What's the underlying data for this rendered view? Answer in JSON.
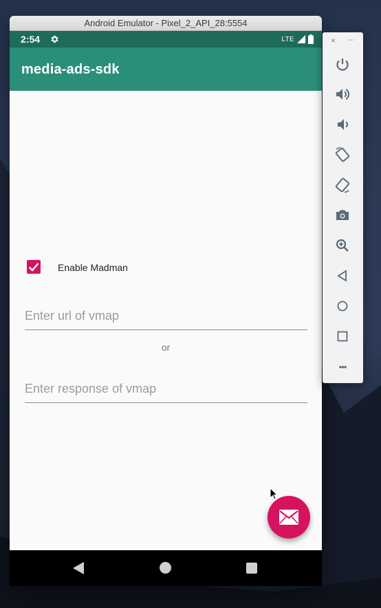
{
  "window": {
    "title": "Android Emulator - Pixel_2_API_28:5554"
  },
  "status_bar": {
    "time": "2:54",
    "network": "LTE"
  },
  "app_bar": {
    "title": "media-ads-sdk"
  },
  "form": {
    "checkbox_label": "Enable Madman",
    "checkbox_checked": true,
    "url_placeholder": "Enter url of vmap",
    "or_label": "or",
    "response_placeholder": "Enter response of vmap"
  },
  "side_toolbar": {
    "close": "×",
    "minimize": "–",
    "tools": [
      "power-icon",
      "volume-up-icon",
      "volume-down-icon",
      "rotate-left-icon",
      "rotate-right-icon",
      "camera-icon",
      "zoom-icon",
      "back-icon",
      "home-icon",
      "overview-icon",
      "more-icon"
    ],
    "more": "•••"
  },
  "colors": {
    "status_bar": "#1e6b5c",
    "app_bar": "#2b8e7a",
    "accent": "#d5135f",
    "tool_icon": "#5a6b7a"
  }
}
